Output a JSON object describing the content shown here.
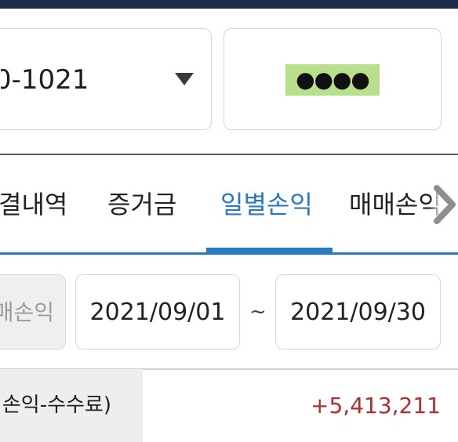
{
  "account": {
    "number": "0-1021",
    "password_mask": "●●●●"
  },
  "tabs": [
    {
      "label": "결내역"
    },
    {
      "label": "증거금"
    },
    {
      "label": "일별손익"
    },
    {
      "label": "매매손익"
    }
  ],
  "active_tab": "일별손익",
  "filter": {
    "type_label": "매손익",
    "date_from": "2021/09/01",
    "separator": "~",
    "date_to": "2021/09/30"
  },
  "summary": {
    "label": "손익-수수료)",
    "value": "+5,413,211"
  },
  "colors": {
    "accent": "#2a79c4",
    "profit": "#b32d2d",
    "header_bar": "#1b2d4c",
    "password_highlight": "#b7df8c"
  },
  "icons": {
    "account_dropdown": "triangle-down",
    "tabs_scroll": "chevron-right"
  }
}
